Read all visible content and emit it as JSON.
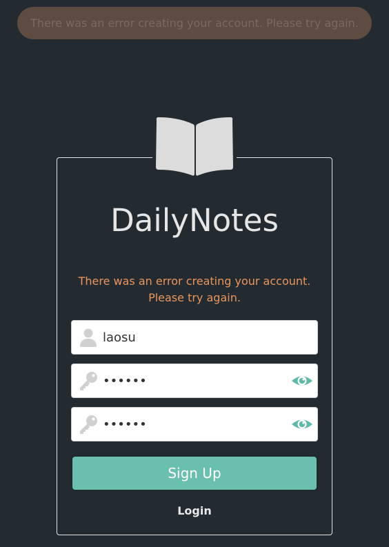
{
  "toast": {
    "text": "There was an error creating your account. Please try again."
  },
  "app": {
    "title": "DailyNotes"
  },
  "form": {
    "error": "There was an error creating your account. Please try again.",
    "username": {
      "value": "laosu",
      "icon": "user-icon"
    },
    "password": {
      "value": "laosu1",
      "icon": "key-icon",
      "toggle_icon": "eye-icon"
    },
    "password_confirm": {
      "value": "laosu1",
      "icon": "key-icon",
      "toggle_icon": "eye-icon"
    },
    "submit_label": "Sign Up",
    "login_label": "Login"
  },
  "colors": {
    "background": "#232b30",
    "accent": "#6bbfae",
    "error": "#e9955e",
    "toast_bg": "#5e4b41"
  }
}
